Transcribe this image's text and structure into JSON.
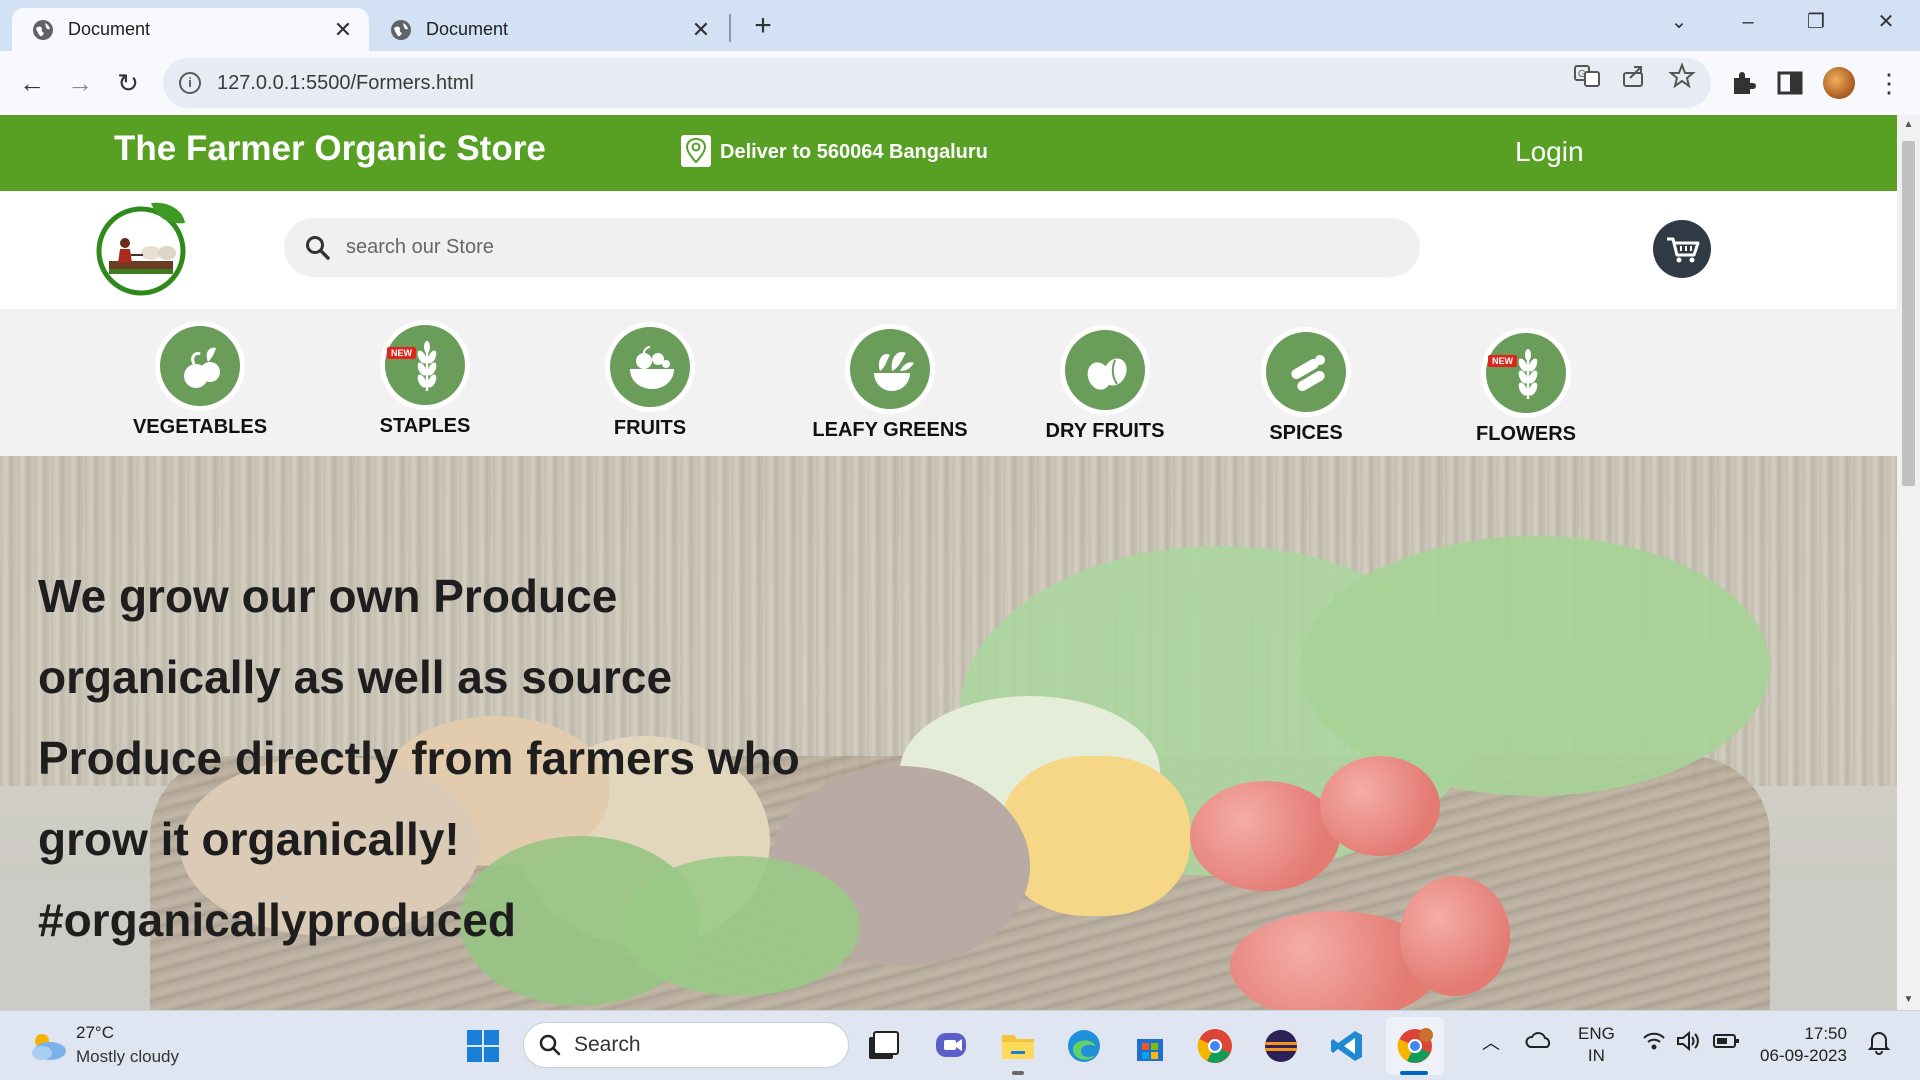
{
  "browser": {
    "tabs": [
      {
        "title": "Document",
        "active": true
      },
      {
        "title": "Document",
        "active": false
      }
    ],
    "url": "127.0.0.1:5500/Formers.html"
  },
  "header": {
    "store_title": "The Farmer Organic Store",
    "deliver_text": "Deliver to 560064 Bangaluru",
    "login_label": "Login"
  },
  "search": {
    "placeholder": "search our Store"
  },
  "categories": [
    {
      "label": "VEGETABLES",
      "icon": "vegetables-icon",
      "new": false
    },
    {
      "label": "STAPLES",
      "icon": "wheat-icon",
      "new": true
    },
    {
      "label": "FRUITS",
      "icon": "fruit-bowl-icon",
      "new": false
    },
    {
      "label": "LEAFY GREENS",
      "icon": "leafy-greens-icon",
      "new": false
    },
    {
      "label": "DRY FRUITS",
      "icon": "nuts-icon",
      "new": false
    },
    {
      "label": "SPICES",
      "icon": "spices-icon",
      "new": false
    },
    {
      "label": "FLOWERS",
      "icon": "wheat-icon",
      "new": true
    }
  ],
  "badge_label": "NEW",
  "hero": {
    "lines": [
      "We grow our own Produce",
      "organically as well as source",
      "Produce directly from farmers who",
      "grow it organically!",
      "#organicallyproduced"
    ]
  },
  "colors": {
    "brand_green": "#57a023",
    "category_green": "#6a9c5a",
    "cart_dark": "#2f3a45"
  },
  "taskbar": {
    "temperature": "27°C",
    "weather": "Mostly cloudy",
    "search_label": "Search",
    "lang_top": "ENG",
    "lang_bottom": "IN",
    "time": "17:50",
    "date": "06-09-2023"
  }
}
